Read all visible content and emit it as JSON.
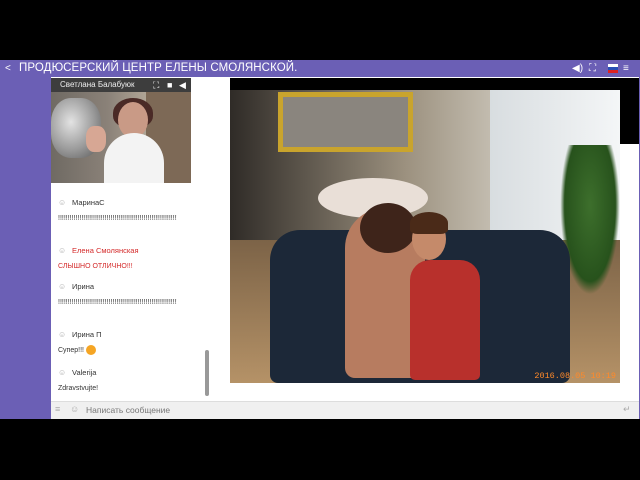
{
  "topbar": {
    "title": "ПРОДЮСЕРСКИЙ ЦЕНТР ЕЛЕНЫ СМОЛЯНСКОЙ.",
    "share_icon": "share-icon",
    "controls": [
      "volume-icon",
      "fullscreen-icon",
      "flag-ru-icon",
      "menu-icon"
    ]
  },
  "video": {
    "name": "Светлана Балабуюк",
    "icons": [
      "expand-icon",
      "camera-icon",
      "play-back-icon"
    ]
  },
  "chat": {
    "messages": [
      {
        "user": "МаринаС",
        "text": "!!!!!!!!!!!!!!!!!!!!!!!!!!!!!!!!!!!!!!!!!!!!!!!!!!!!!!!!!!!!!",
        "admin": false
      },
      {
        "user": "Елена Смолянская",
        "text": "СЛЫШНО ОТЛИЧНО!!!",
        "admin": true
      },
      {
        "user": "Ирина",
        "text": "!!!!!!!!!!!!!!!!!!!!!!!!!!!!!!!!!!!!!!!!!!!!!!!!!!!!!!!!!!!!!",
        "admin": false
      },
      {
        "user": "Ирина П",
        "text": "Супер!!!",
        "admin": false
      },
      {
        "user": "Valerija",
        "text": "Zdravstvujte!",
        "admin": false
      }
    ]
  },
  "input": {
    "placeholder": "Написать сообщение"
  },
  "photo": {
    "date": "2016.08.05 10:19"
  },
  "colors": {
    "brand": "#6b5fb5",
    "admin_text": "#d42a2a",
    "date_stamp": "#ff8a2a"
  }
}
